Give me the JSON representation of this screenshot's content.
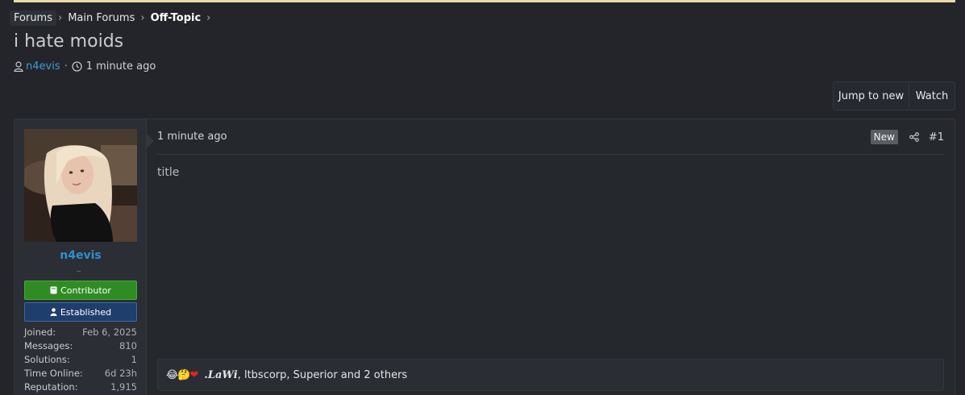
{
  "breadcrumb": {
    "items": [
      "Forums",
      "Main Forums",
      "Off-Topic"
    ]
  },
  "thread": {
    "title": "i hate moids",
    "author": "n4evis",
    "time": "1 minute ago"
  },
  "actions": {
    "jump_label": "Jump to new",
    "watch_label": "Watch"
  },
  "user": {
    "name": "n4evis",
    "badges": [
      "Contributor",
      "Established"
    ],
    "stats": [
      {
        "label": "Joined:",
        "value": "Feb 6, 2025"
      },
      {
        "label": "Messages:",
        "value": "810"
      },
      {
        "label": "Solutions:",
        "value": "1"
      },
      {
        "label": "Time Online:",
        "value": "6d 23h"
      },
      {
        "label": "Reputation:",
        "value": "1,915"
      }
    ]
  },
  "post": {
    "time": "1 minute ago",
    "new_label": "New",
    "number": "#1",
    "body": "title"
  },
  "reactions": {
    "icons": [
      "laughing-emoji",
      "thinking-emoji",
      "heart-emoji"
    ],
    "users_first": ".LaWi",
    "users_rest": ", ltbscorp, Superior and 2 others"
  },
  "colors": {
    "accent": "#2f8fd0",
    "contributor": "#2f8c23",
    "established": "#1e3e6b",
    "top_bar": "#e9dba9"
  }
}
